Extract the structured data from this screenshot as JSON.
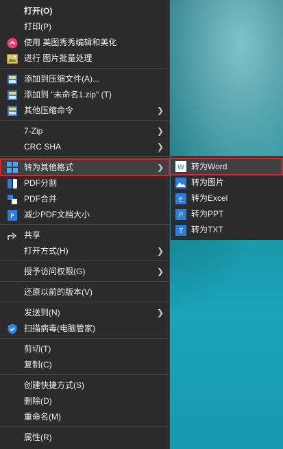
{
  "menu": {
    "items": [
      {
        "label": "打开(O)"
      },
      {
        "label": "打印(P)"
      },
      {
        "label": "使用 美图秀秀编辑和美化"
      },
      {
        "label": "进行 图片批量处理"
      },
      {
        "label": "添加到压缩文件(A)..."
      },
      {
        "label": "添加到 \"未命名1.zip\" (T)"
      },
      {
        "label": "其他压缩命令"
      },
      {
        "label": "7-Zip"
      },
      {
        "label": "CRC SHA"
      },
      {
        "label": "转为其他格式"
      },
      {
        "label": "PDF分割"
      },
      {
        "label": "PDF合并"
      },
      {
        "label": "减少PDF文档大小"
      },
      {
        "label": "共享"
      },
      {
        "label": "打开方式(H)"
      },
      {
        "label": "授予访问权限(G)"
      },
      {
        "label": "还原以前的版本(V)"
      },
      {
        "label": "发送到(N)"
      },
      {
        "label": "扫描病毒(电脑管家)"
      },
      {
        "label": "剪切(T)"
      },
      {
        "label": "复制(C)"
      },
      {
        "label": "创建快捷方式(S)"
      },
      {
        "label": "删除(D)"
      },
      {
        "label": "重命名(M)"
      },
      {
        "label": "属性(R)"
      }
    ]
  },
  "submenu": {
    "items": [
      {
        "label": "转为Word",
        "icon_letter": "W"
      },
      {
        "label": "转为图片",
        "icon_letter": ""
      },
      {
        "label": "转为Excel",
        "icon_letter": "E"
      },
      {
        "label": "转为PPT",
        "icon_letter": "P"
      },
      {
        "label": "转为TXT",
        "icon_letter": "T"
      }
    ]
  },
  "colors": {
    "menu_bg": "#2b2b2b",
    "highlight_bg": "#404040",
    "highlight_border": "#e0242f",
    "icon_blue": "#2a7de1"
  }
}
